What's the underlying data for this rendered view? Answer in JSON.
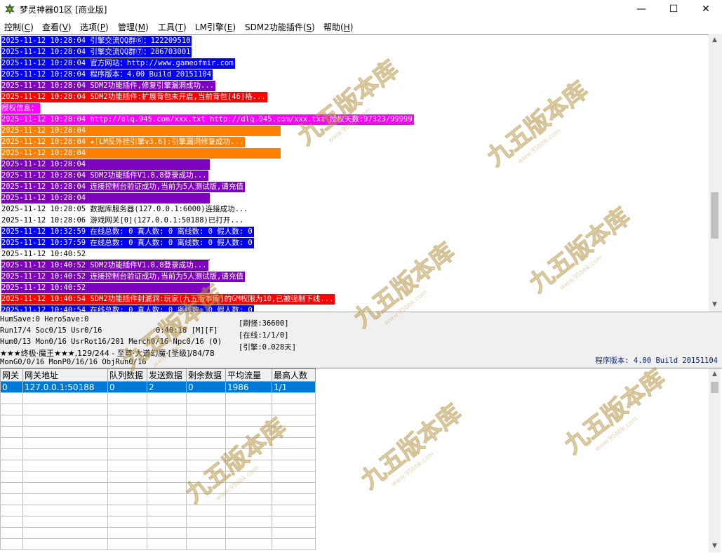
{
  "window": {
    "title": "梦灵神器01区 [商业版]",
    "controls": {
      "minimize": "—",
      "maximize": "☐",
      "close": "✕"
    }
  },
  "menu": [
    {
      "label": "控制",
      "key": "C"
    },
    {
      "label": "查看",
      "key": "V"
    },
    {
      "label": "选项",
      "key": "P"
    },
    {
      "label": "管理",
      "key": "M"
    },
    {
      "label": "工具",
      "key": "T"
    },
    {
      "label": "LM引擎",
      "key": "E"
    },
    {
      "label": "SDM2功能插件",
      "key": "S"
    },
    {
      "label": "帮助",
      "key": "H"
    }
  ],
  "log": [
    {
      "text": "2025-11-12 10:28:04 引擎交流QQ群⑥：122209510",
      "bg": "#0000ff",
      "fg": "#ffffff"
    },
    {
      "text": "2025-11-12 10:28:04 引擎交流QQ群⑦：286703001",
      "bg": "#0000ff",
      "fg": "#ffffff"
    },
    {
      "text": "2025-11-12 10:28:04 官方网站：http://www.gameofmir.com",
      "bg": "#0000ff",
      "fg": "#ffffff"
    },
    {
      "text": "2025-11-12 10:28:04 程序版本：4.00 Build 20151104",
      "bg": "#0000ff",
      "fg": "#ffffff"
    },
    {
      "text": "2025-11-12 10:28:04 SDM2功能插件,修复引擎漏洞成功...",
      "bg": "#8000c0",
      "fg": "#ffffff"
    },
    {
      "text": "2025-11-12 10:28:04 SDM2功能插件:扩展背包未开启,当前背包[46]格...",
      "bg": "#ff0000",
      "fg": "#ffffff"
    },
    {
      "text": "授权信息：",
      "bg": "#ff00ff",
      "fg": "#ffffff"
    },
    {
      "text": "2025-11-12 10:28:04 http://dlq.945.com/xxx.txt http://dlq.945.com/xxx.txt 授权天数:97323/99999",
      "bg": "#ff00ff",
      "fg": "#ffffff"
    },
    {
      "text": "2025-11-12 10:28:04 ",
      "bg": "#ff8000",
      "fg": "#ffffff",
      "pad": 396
    },
    {
      "text": "2025-11-12 10:28:04 ★[LM反外挂引擎v3.6]:引擎漏洞修复成功...",
      "bg": "#ff8000",
      "fg": "#ffffff"
    },
    {
      "text": "2025-11-12 10:28:04 ",
      "bg": "#ff8000",
      "fg": "#ffffff",
      "pad": 396
    },
    {
      "text": "2025-11-12 10:28:04 ",
      "bg": "#8000c0",
      "fg": "#ffffff",
      "pad": 295
    },
    {
      "text": "2025-11-12 10:28:04 SDM2功能插件V1.8.8登录成功...",
      "bg": "#8000c0",
      "fg": "#ffffff"
    },
    {
      "text": "2025-11-12 10:28:04 连接控制台验证成功,当前为5人测试版,请充值",
      "bg": "#8000c0",
      "fg": "#ffffff"
    },
    {
      "text": "2025-11-12 10:28:04 ",
      "bg": "#8000c0",
      "fg": "#ffffff",
      "pad": 295
    },
    {
      "text": "2025-11-12 10:28:05 数据库服务器(127.0.0.1:6000)连接成功...",
      "bg": "#ffffff",
      "fg": "#000000"
    },
    {
      "text": "2025-11-12 10:28:06 游戏网关[0](127.0.0.1:50188)已打开...",
      "bg": "#ffffff",
      "fg": "#000000"
    },
    {
      "text": "2025-11-12 10:32:59 在线总数: 0 真人数: 0 离线数: 0 假人数: 0",
      "bg": "#0000ff",
      "fg": "#ffffff"
    },
    {
      "text": "2025-11-12 10:37:59 在线总数: 0 真人数: 0 离线数: 0 假人数: 0",
      "bg": "#0000ff",
      "fg": "#ffffff"
    },
    {
      "text": "2025-11-12 10:40:52 ",
      "bg": "#ffffff",
      "fg": "#000000",
      "pad": 295,
      "underline": true
    },
    {
      "text": "2025-11-12 10:40:52 SDM2功能插件V1.8.8登录成功...",
      "bg": "#8000c0",
      "fg": "#ffffff"
    },
    {
      "text": "2025-11-12 10:40:52 连接控制台验证成功,当前为5人测试版,请充值",
      "bg": "#8000c0",
      "fg": "#ffffff"
    },
    {
      "text": "2025-11-12 10:40:52 ",
      "bg": "#8000c0",
      "fg": "#ffffff",
      "pad": 295
    },
    {
      "text": "2025-11-12 10:40:54 SDM2功能插件封漏洞:玩家[九五版本库]的GM权限为10,已被强制下线...",
      "bg": "#ff0000",
      "fg": "#ffffff"
    },
    {
      "text": "2025-11-12 10:40:54 在线总数: 0 真人数: 0 离线数: 0 假人数: 0",
      "bg": "#0000ff",
      "fg": "#ffffff"
    }
  ],
  "status": {
    "line1": "HumSave:0 HeroSave:0",
    "line2": "Run17/4 Soc0/15 Usr0/16",
    "time": "0:40:18 [M][F]",
    "line3": "Hum0/13 Mon0/16 UsrRot16/201 Merch0/16 Npc0/16 (0)",
    "line4": "★★★终极·魔王★★★,129/244 - 至尊·大道幻魔·[圣级]/84/78",
    "line5": "MonG0/0/16 MonP0/16/16 ObjRun0/16",
    "brush": "[刷怪:36600]",
    "online": "[在线:1/1/0]",
    "engine": "[引擎:0.028天]",
    "version": "程序版本: 4.00 Build 20151104"
  },
  "grid": {
    "headers": [
      "网关",
      "网关地址",
      "队列数据",
      "发送数据",
      "剩余数据",
      "平均流量",
      "最高人数"
    ],
    "rows": [
      [
        "0",
        "127.0.0.1:50188",
        "0",
        "2",
        "0",
        "1986",
        "1/1"
      ]
    ]
  },
  "watermark": {
    "brand": "九五版本库",
    "url": "www.95bbk.com"
  },
  "colors": {
    "selection": "#0078d7",
    "version_text": "#0a246a"
  }
}
